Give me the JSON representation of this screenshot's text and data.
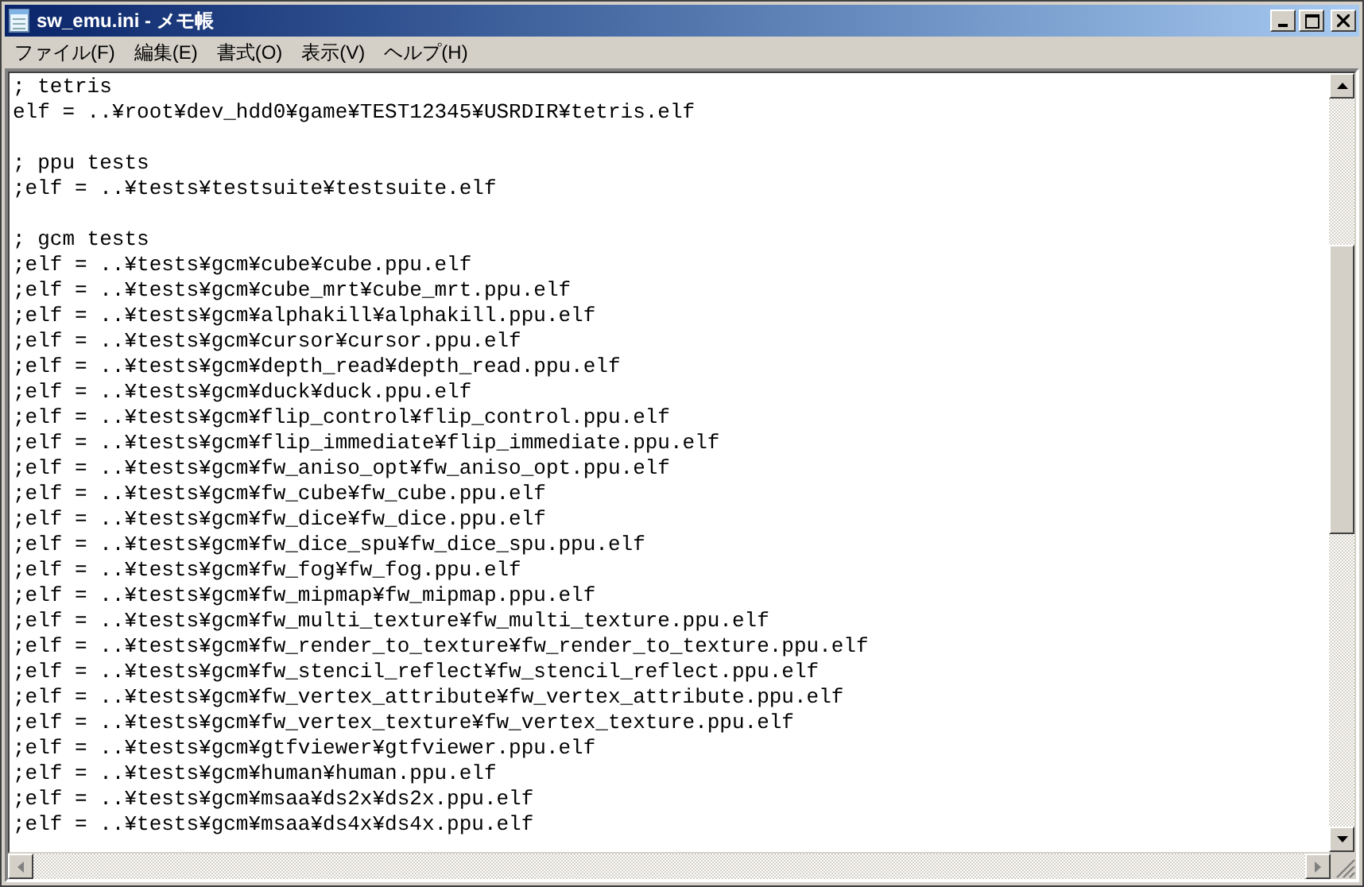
{
  "window": {
    "title": "sw_emu.ini - メモ帳"
  },
  "menu": [
    "ファイル(F)",
    "編集(E)",
    "書式(O)",
    "表示(V)",
    "ヘルプ(H)"
  ],
  "editor": {
    "sections": [
      {
        "lines": [
          "; tetris",
          "elf = ..¥root¥dev_hdd0¥game¥TEST12345¥USRDIR¥tetris.elf"
        ]
      },
      {
        "lines": [
          "; ppu tests",
          ";elf = ..¥tests¥testsuite¥testsuite.elf"
        ]
      },
      {
        "lines": [
          "; gcm tests",
          ";elf = ..¥tests¥gcm¥cube¥cube.ppu.elf",
          ";elf = ..¥tests¥gcm¥cube_mrt¥cube_mrt.ppu.elf",
          ";elf = ..¥tests¥gcm¥alphakill¥alphakill.ppu.elf",
          ";elf = ..¥tests¥gcm¥cursor¥cursor.ppu.elf",
          ";elf = ..¥tests¥gcm¥depth_read¥depth_read.ppu.elf",
          ";elf = ..¥tests¥gcm¥duck¥duck.ppu.elf",
          ";elf = ..¥tests¥gcm¥flip_control¥flip_control.ppu.elf",
          ";elf = ..¥tests¥gcm¥flip_immediate¥flip_immediate.ppu.elf",
          ";elf = ..¥tests¥gcm¥fw_aniso_opt¥fw_aniso_opt.ppu.elf",
          ";elf = ..¥tests¥gcm¥fw_cube¥fw_cube.ppu.elf",
          ";elf = ..¥tests¥gcm¥fw_dice¥fw_dice.ppu.elf",
          ";elf = ..¥tests¥gcm¥fw_dice_spu¥fw_dice_spu.ppu.elf",
          ";elf = ..¥tests¥gcm¥fw_fog¥fw_fog.ppu.elf",
          ";elf = ..¥tests¥gcm¥fw_mipmap¥fw_mipmap.ppu.elf",
          ";elf = ..¥tests¥gcm¥fw_multi_texture¥fw_multi_texture.ppu.elf",
          ";elf = ..¥tests¥gcm¥fw_render_to_texture¥fw_render_to_texture.ppu.elf",
          ";elf = ..¥tests¥gcm¥fw_stencil_reflect¥fw_stencil_reflect.ppu.elf",
          ";elf = ..¥tests¥gcm¥fw_vertex_attribute¥fw_vertex_attribute.ppu.elf",
          ";elf = ..¥tests¥gcm¥fw_vertex_texture¥fw_vertex_texture.ppu.elf",
          ";elf = ..¥tests¥gcm¥gtfviewer¥gtfviewer.ppu.elf",
          ";elf = ..¥tests¥gcm¥human¥human.ppu.elf",
          ";elf = ..¥tests¥gcm¥msaa¥ds2x¥ds2x.ppu.elf",
          ";elf = ..¥tests¥gcm¥msaa¥ds4x¥ds4x.ppu.elf"
        ]
      }
    ]
  }
}
